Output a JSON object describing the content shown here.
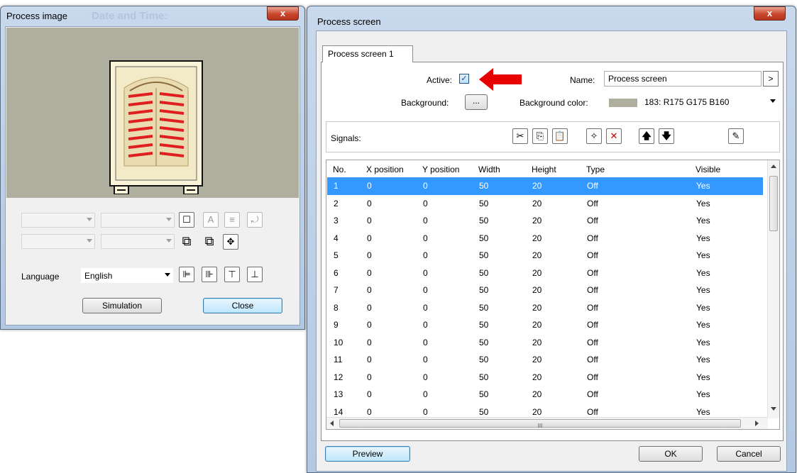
{
  "left_window": {
    "title": "Process image",
    "title_ghost": "Date and Time:",
    "close_glyph": "x",
    "preview_bg": "#afaf9f",
    "language_label": "Language",
    "language_value": "English",
    "simulation_label": "Simulation",
    "close_label": "Close"
  },
  "right_window": {
    "title": "Process screen",
    "close_glyph": "x",
    "tab_label": "Process screen 1",
    "active_label": "Active:",
    "active_checked": true,
    "name_label": "Name:",
    "name_value": "Process screen",
    "name_button": ">",
    "background_label": "Background:",
    "background_button": "...",
    "bgcolor_label": "Background color:",
    "bgcolor_value": "183: R175 G175 B160",
    "bgcolor_swatch": "#afaf9f",
    "signals_label": "Signals:",
    "columns": [
      "No.",
      "X position",
      "Y position",
      "Width",
      "Height",
      "Type",
      "Visible"
    ],
    "rows": [
      [
        "1",
        "0",
        "0",
        "50",
        "20",
        "Off",
        "Yes"
      ],
      [
        "2",
        "0",
        "0",
        "50",
        "20",
        "Off",
        "Yes"
      ],
      [
        "3",
        "0",
        "0",
        "50",
        "20",
        "Off",
        "Yes"
      ],
      [
        "4",
        "0",
        "0",
        "50",
        "20",
        "Off",
        "Yes"
      ],
      [
        "5",
        "0",
        "0",
        "50",
        "20",
        "Off",
        "Yes"
      ],
      [
        "6",
        "0",
        "0",
        "50",
        "20",
        "Off",
        "Yes"
      ],
      [
        "7",
        "0",
        "0",
        "50",
        "20",
        "Off",
        "Yes"
      ],
      [
        "8",
        "0",
        "0",
        "50",
        "20",
        "Off",
        "Yes"
      ],
      [
        "9",
        "0",
        "0",
        "50",
        "20",
        "Off",
        "Yes"
      ],
      [
        "10",
        "0",
        "0",
        "50",
        "20",
        "Off",
        "Yes"
      ],
      [
        "11",
        "0",
        "0",
        "50",
        "20",
        "Off",
        "Yes"
      ],
      [
        "12",
        "0",
        "0",
        "50",
        "20",
        "Off",
        "Yes"
      ],
      [
        "13",
        "0",
        "0",
        "50",
        "20",
        "Off",
        "Yes"
      ],
      [
        "14",
        "0",
        "0",
        "50",
        "20",
        "Off",
        "Yes"
      ]
    ],
    "selected_row": "1",
    "hscroll_grip": "III",
    "preview_label": "Preview",
    "ok_label": "OK",
    "cancel_label": "Cancel"
  },
  "colors": {
    "selection": "#3399ff",
    "annotation_arrow": "#e60000",
    "heating_bars": "#e02020"
  }
}
